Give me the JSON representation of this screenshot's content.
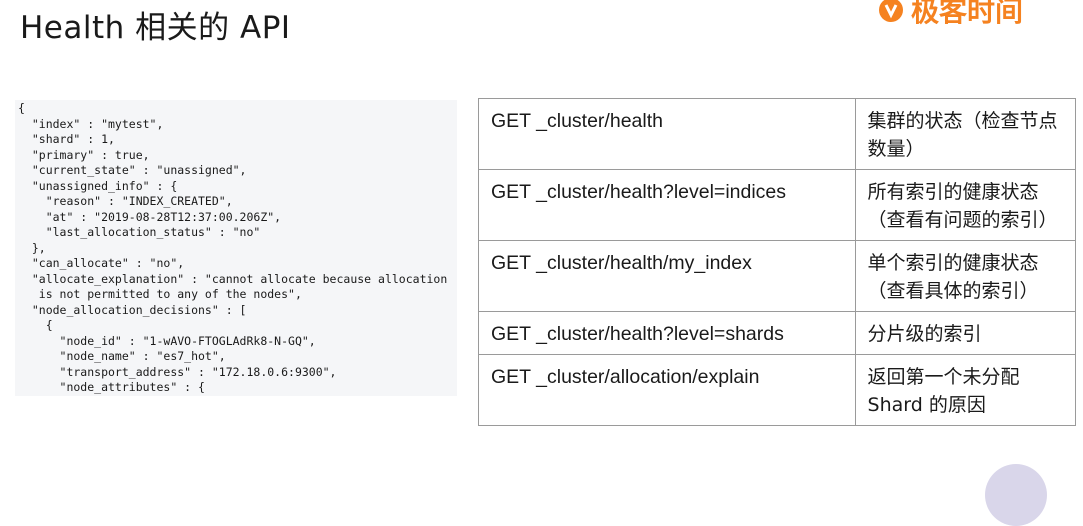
{
  "title": "Health 相关的 API",
  "logo": {
    "text": "极客时间",
    "icon": "geektime-logo-icon"
  },
  "code_lines": [
    "{",
    "  \"index\" : \"mytest\",",
    "  \"shard\" : 1,",
    "  \"primary\" : true,",
    "  \"current_state\" : \"unassigned\",",
    "  \"unassigned_info\" : {",
    "    \"reason\" : \"INDEX_CREATED\",",
    "    \"at\" : \"2019-08-28T12:37:00.206Z\",",
    "    \"last_allocation_status\" : \"no\"",
    "  },",
    "  \"can_allocate\" : \"no\",",
    "  \"allocate_explanation\" : \"cannot allocate because allocation",
    "   is not permitted to any of the nodes\",",
    "  \"node_allocation_decisions\" : [",
    "    {",
    "      \"node_id\" : \"1-wAVO-FTOGLAdRk8-N-GQ\",",
    "      \"node_name\" : \"es7_hot\",",
    "      \"transport_address\" : \"172.18.0.6:9300\",",
    "      \"node_attributes\" : {"
  ],
  "api_rows": [
    {
      "endpoint": "GET _cluster/health",
      "desc": "集群的状态（检查节点数量）"
    },
    {
      "endpoint": "GET _cluster/health?level=indices",
      "desc": "所有索引的健康状态 （查看有问题的索引）"
    },
    {
      "endpoint": "GET _cluster/health/my_index",
      "desc": "单个索引的健康状态（查看具体的索引）"
    },
    {
      "endpoint": "GET _cluster/health?level=shards",
      "desc": "分片级的索引"
    },
    {
      "endpoint": "GET _cluster/allocation/explain",
      "desc": "返回第一个未分配Shard 的原因"
    }
  ]
}
